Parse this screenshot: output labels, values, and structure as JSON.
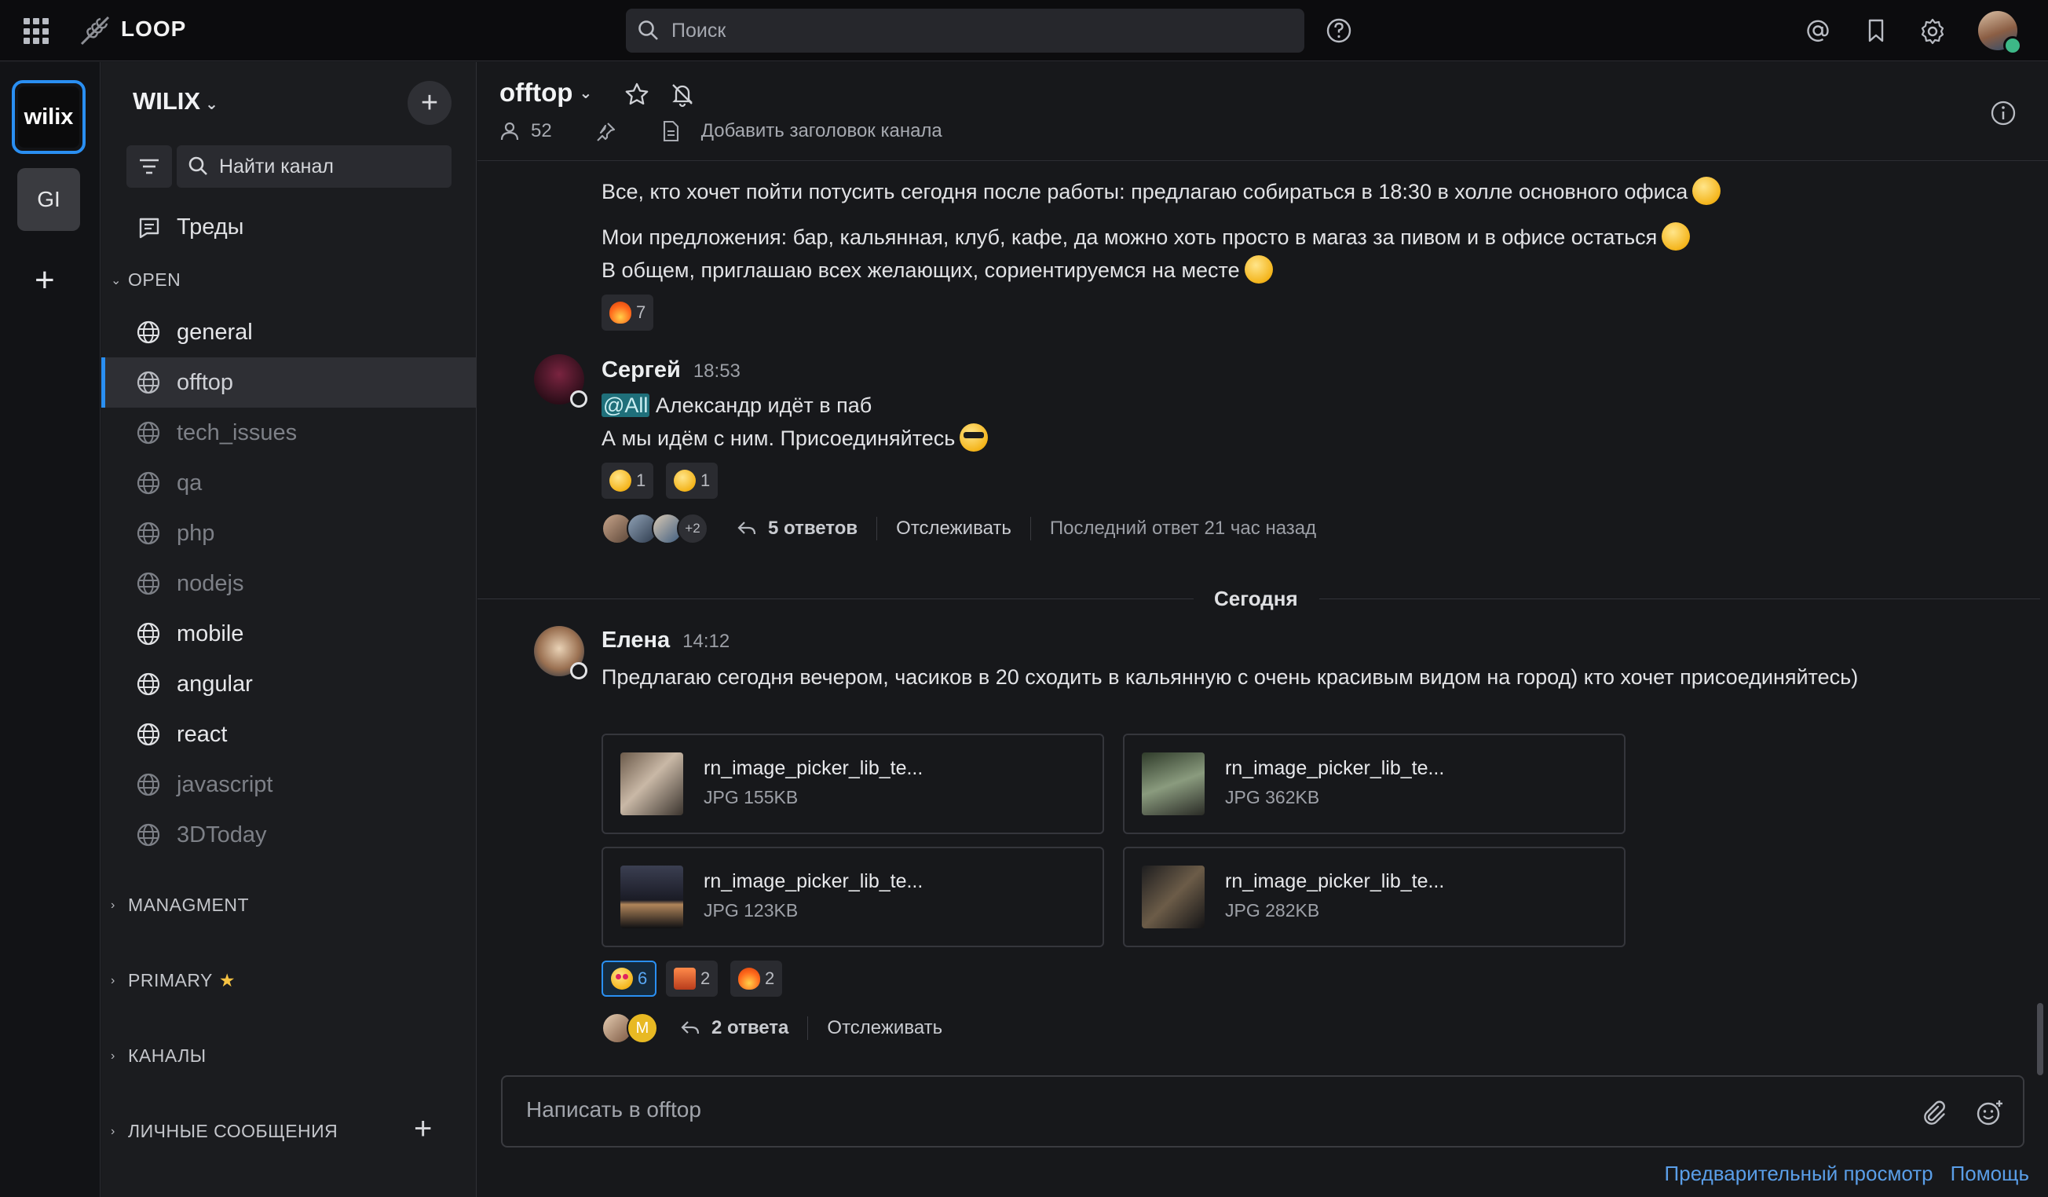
{
  "app": {
    "name": "LOOP"
  },
  "topbar": {
    "search_placeholder": "Поиск"
  },
  "teams": {
    "active_label": "wilix",
    "second_label": "GI"
  },
  "sidebar": {
    "team_name": "WILIX",
    "channel_search_placeholder": "Найти канал",
    "threads_label": "Треды",
    "section_open": "OPEN",
    "channels": [
      {
        "name": "general",
        "state": "bright"
      },
      {
        "name": "offtop",
        "state": "active"
      },
      {
        "name": "tech_issues",
        "state": "dim"
      },
      {
        "name": "qa",
        "state": "dim"
      },
      {
        "name": "php",
        "state": "dim"
      },
      {
        "name": "nodejs",
        "state": "dim"
      },
      {
        "name": "mobile",
        "state": "bright"
      },
      {
        "name": "angular",
        "state": "bright"
      },
      {
        "name": "react",
        "state": "bright"
      },
      {
        "name": "javascript",
        "state": "dim"
      },
      {
        "name": "3DToday",
        "state": "dim"
      }
    ],
    "sections": [
      "MANAGMENT",
      "PRIMARY",
      "КАНАЛЫ",
      "ЛИЧНЫЕ СООБЩЕНИЯ"
    ]
  },
  "channel": {
    "name": "offtop",
    "members": "52",
    "add_header": "Добавить заголовок канала"
  },
  "messages": {
    "m1": {
      "line1": "Все, кто хочет пойти потусить сегодня после работы: предлагаю собираться в 18:30 в холле основного офиса",
      "line2": "Мои предложения: бар, кальянная, клуб, кафе, да можно хоть просто в магаз за пивом и в офисе остаться",
      "line3": "В общем, приглашаю всех желающих, сориентируемся на месте",
      "reaction_count": "7"
    },
    "m2": {
      "author": "Сергей",
      "time": "18:53",
      "mention": "@All",
      "line1_rest": " Александр идёт в паб",
      "line2": "А мы идём с ним.  Присоединяйтесь",
      "reactions": [
        "1",
        "1"
      ],
      "more_count": "+2",
      "replies": "5 ответов",
      "follow": "Отслеживать",
      "last_reply": "Последний ответ 21 час назад"
    },
    "date_separator": "Сегодня",
    "m3": {
      "author": "Елена",
      "time": "14:12",
      "text": "Предлагаю сегодня вечером, часиков в 20 сходить в кальянную с очень красивым видом на город) кто хочет присоединяйтесь)",
      "files": [
        {
          "name": "rn_image_picker_lib_te...",
          "meta": "JPG 155KB"
        },
        {
          "name": "rn_image_picker_lib_te...",
          "meta": "JPG 362KB"
        },
        {
          "name": "rn_image_picker_lib_te...",
          "meta": "JPG 123KB"
        },
        {
          "name": "rn_image_picker_lib_te...",
          "meta": "JPG 282KB"
        }
      ],
      "reactions": [
        "6",
        "2",
        "2"
      ],
      "avatar_letter": "M",
      "replies": "2 ответа",
      "follow": "Отслеживать"
    }
  },
  "composer": {
    "placeholder": "Написать в offtop"
  },
  "footer": {
    "preview": "Предварительный просмотр",
    "help": "Помощь"
  },
  "colors": {
    "accent": "#2a8ff2",
    "online": "#3db887",
    "mention_bg": "#1f6f7a"
  }
}
